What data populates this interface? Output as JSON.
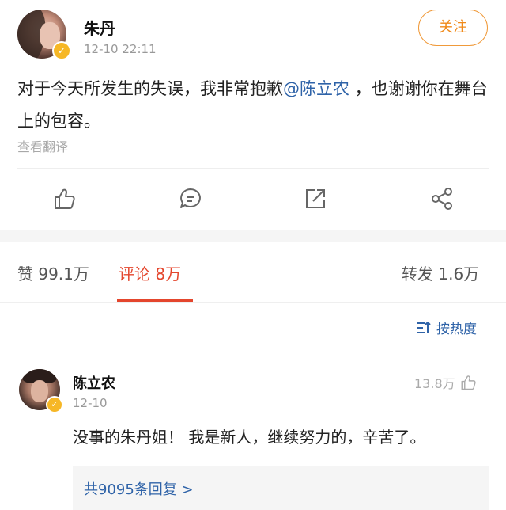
{
  "post": {
    "author": "朱丹",
    "time": "12-10 22:11",
    "follow_label": "关注",
    "text_before": "对于今天所发生的失误，我非常抱歉",
    "mention": "@陈立农",
    "text_after": " ，也谢谢你在舞台上的包容。",
    "translate_label": "查看翻译"
  },
  "actions": [
    "like-icon",
    "comment-icon",
    "forward-icon",
    "share-icon"
  ],
  "stats": {
    "likes_label": "赞 99.1万",
    "comments_label": "评论 8万",
    "reposts_label": "转发 1.6万"
  },
  "sort_label": "按热度",
  "comment": {
    "author": "陈立农",
    "time": "12-10",
    "likes": "13.8万",
    "text": "没事的朱丹姐！ 我是新人，继续努力的，辛苦了。",
    "replies_label": "共9095条回复 >"
  },
  "colors": {
    "accent": "#e4462d",
    "link": "#2f63a8",
    "follow": "#f08a1a",
    "verified": "#f6b726"
  }
}
